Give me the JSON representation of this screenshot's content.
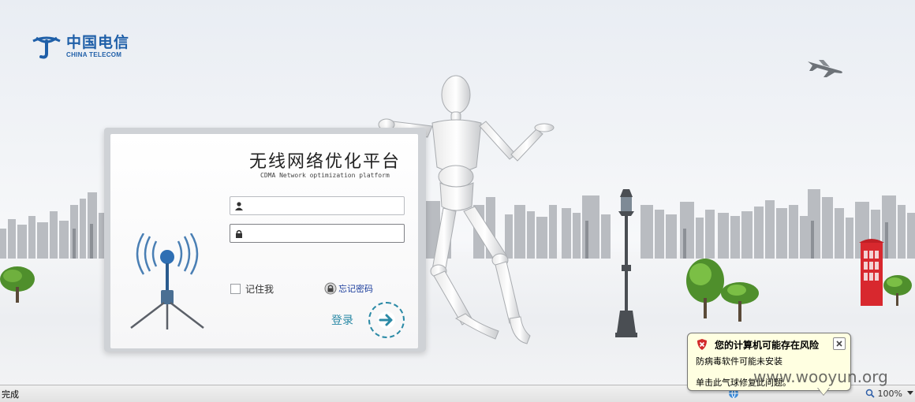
{
  "brand": {
    "name_cn": "中国电信",
    "name_en": "CHINA TELECOM"
  },
  "login": {
    "title": "无线网络优化平台",
    "subtitle": "CDMA Network optimization platform",
    "username_value": "",
    "password_value": "",
    "remember_label": "记住我",
    "forgot_label": "忘记密码",
    "login_label": "登录",
    "icons": {
      "username": "user-icon",
      "password": "lock-icon",
      "forgot": "key-lock-icon",
      "submit": "arrow-right-icon"
    }
  },
  "statusbar": {
    "status": "完成",
    "zoom": "100%"
  },
  "balloon": {
    "title": "您的计算机可能存在风险",
    "line1": "防病毒软件可能未安装",
    "line2": "单击此气球修复此问题。",
    "icon": "shield-warning-icon"
  },
  "watermark": "www.wooyun.org",
  "colors": {
    "brand_blue": "#1f5fa8",
    "accent_teal": "#2b8aa6",
    "balloon_bg": "#ffffe1",
    "phone_booth_red": "#d8282e"
  }
}
